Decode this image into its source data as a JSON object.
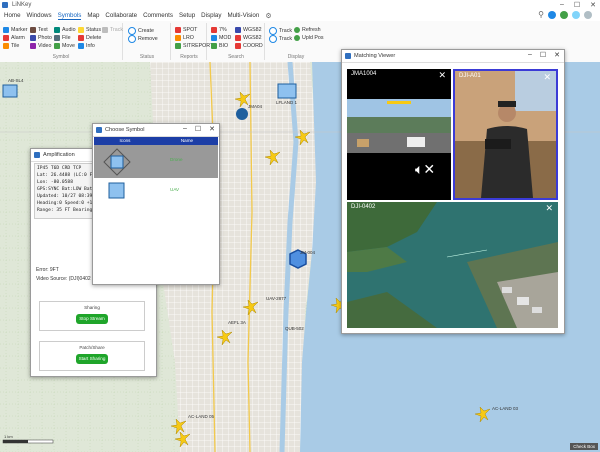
{
  "window": {
    "title": "LiNKey",
    "minimize": "–",
    "maximize": "☐",
    "close": "✕"
  },
  "menu": [
    "Home",
    "Windows",
    "Symbols",
    "Map",
    "Collaborate",
    "Comments",
    "Setup",
    "Display",
    "Multi-Vision"
  ],
  "menu_active": "Symbols",
  "status_colors": {
    "blue": "#1e88e5",
    "green": "#43a047",
    "lightblue": "#81d4fa",
    "gray": "#b0bec5"
  },
  "ribbon": {
    "col1": [
      "Marker",
      "Alarm",
      "Tile"
    ],
    "col2": [
      "Text",
      "Photo",
      "Video"
    ],
    "col3": [
      "Audio",
      "File",
      "Move"
    ],
    "col4": [
      "Status",
      "Delete",
      "Info"
    ],
    "col5": [
      "Track"
    ],
    "symbol_label": "Symbol",
    "status_col": [
      "Create",
      "Remove"
    ],
    "status_label": "Status",
    "reports_col1": [
      "SPOT",
      "LRO",
      "SITREPORT"
    ],
    "reports_label": "Reports",
    "search_col1": [
      "7%",
      "MOD",
      "BIO"
    ],
    "search_col2": [
      "WGS82",
      "WGS82",
      "COORD"
    ],
    "search_label": "Search",
    "display_col1": [
      "Track",
      "Track"
    ],
    "display_col2": [
      "Refresh",
      "Upld Pos"
    ],
    "display_label": "Display"
  },
  "amplification": {
    "title": "Amplification",
    "lines": [
      "IP45 T6D CRD TCP",
      "Lat: 26.4488 (LC:0 FT)",
      "Lon: -80.0588",
      "GPS:SYNC   Bat:LOW Batt",
      "Updated: 10/27 08:39:11",
      "Heading:0 Speed:0 +1.9 ft",
      "Range: 35 FT Bearing: 3"
    ],
    "error_label": "Error: 9FT",
    "video_source": "Video Source: (DJI)0402 EOS0-1",
    "sharing_label": "Sharing",
    "sharing_button": "Stop Stream",
    "patch_label": "Patch/Share",
    "patch_button": "Start Sharing"
  },
  "choose_symbol": {
    "title": "Choose Symbol",
    "headers": [
      "Icons",
      "Name"
    ],
    "rows": [
      {
        "name": "Drone"
      },
      {
        "name": "UAV"
      }
    ]
  },
  "multi_view": {
    "title": "Matching Viewer",
    "tiles": [
      "JMA1004",
      "DJI-A01",
      "DJI-0402"
    ],
    "close": "✕"
  },
  "map_labels": [
    "AB-SL4",
    "JMA04",
    "LFLAND 1",
    "JM-004",
    "UAV-2877",
    "QUB-502",
    "AEFL 3A",
    "AC-LAND 05",
    "AC-LAND 03"
  ],
  "footer": {
    "scale": "1 km",
    "check": "Check Box"
  }
}
